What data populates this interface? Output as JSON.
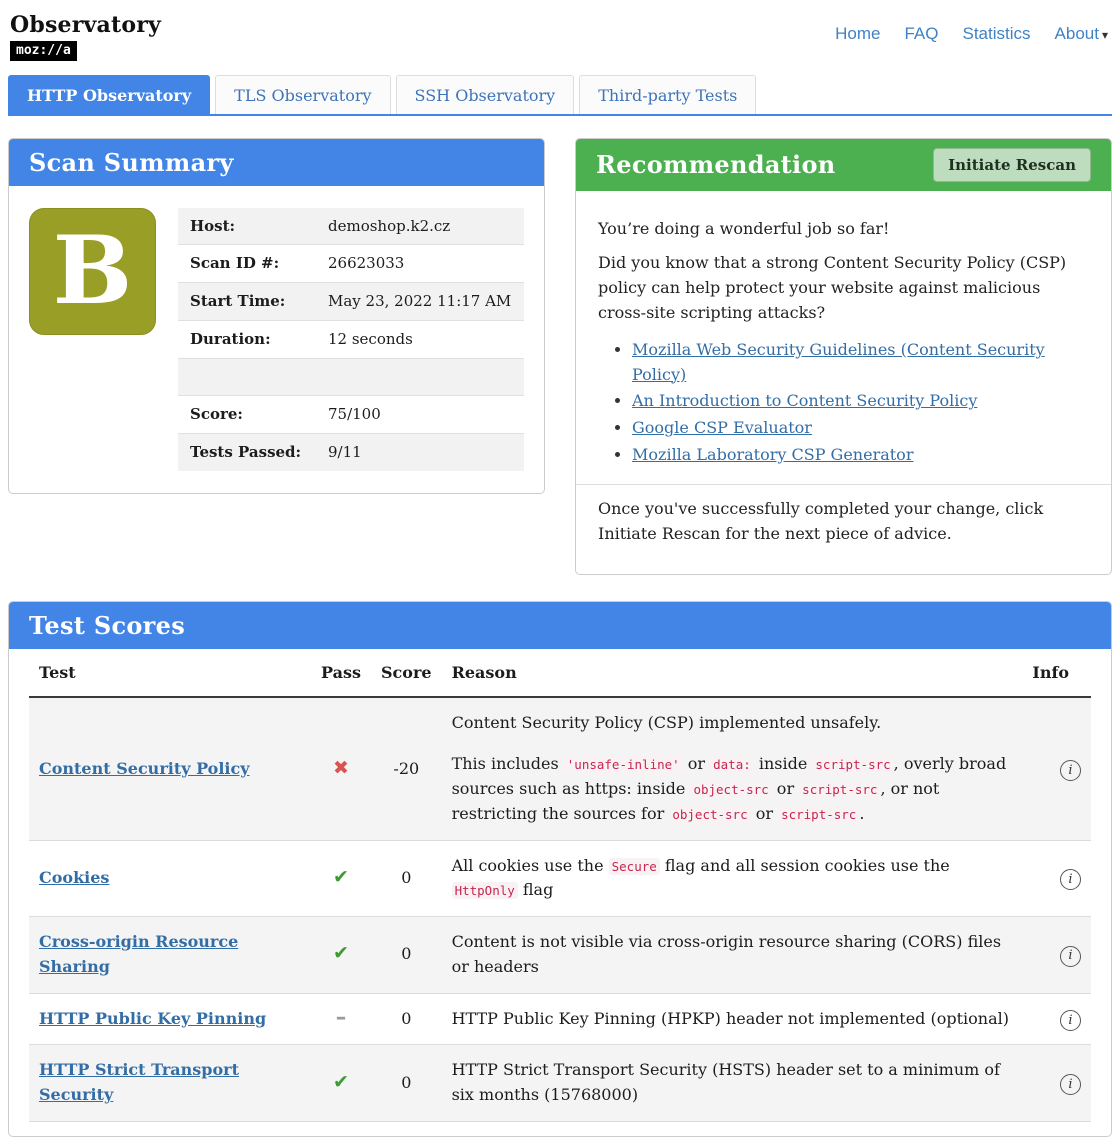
{
  "colors": {
    "accent-blue": "#4285e6",
    "accent-green": "#4caf50",
    "grade-b": "#999e26",
    "link-blue": "#336da6",
    "nav-blue": "#4082c4",
    "code-red": "#c7254e",
    "fail-red": "#d9534f",
    "pass-green": "#3d9b35",
    "neutral-gray": "#9a9a9a"
  },
  "icons": {
    "caret_down": "▾",
    "fail": "✖",
    "pass": "✔",
    "neutral": "–",
    "info": "i"
  },
  "header": {
    "title": "Observatory",
    "logo": "moz://a",
    "nav": [
      {
        "label": "Home"
      },
      {
        "label": "FAQ"
      },
      {
        "label": "Statistics"
      },
      {
        "label": "About",
        "dropdown": true
      }
    ]
  },
  "tabs": [
    {
      "label": "HTTP Observatory",
      "active": true
    },
    {
      "label": "TLS Observatory",
      "active": false
    },
    {
      "label": "SSH Observatory",
      "active": false
    },
    {
      "label": "Third-party Tests",
      "active": false
    }
  ],
  "scan_summary": {
    "title": "Scan Summary",
    "grade": "B",
    "rows": [
      {
        "label": "Host:",
        "value": "demoshop.k2.cz"
      },
      {
        "label": "Scan ID #:",
        "value": "26623033"
      },
      {
        "label": "Start Time:",
        "value": "May 23, 2022 11:17 AM"
      },
      {
        "label": "Duration:",
        "value": "12 seconds"
      },
      {
        "label": "",
        "value": ""
      },
      {
        "label": "Score:",
        "value": "75/100"
      },
      {
        "label": "Tests Passed:",
        "value": "9/11"
      }
    ]
  },
  "recommendation": {
    "title": "Recommendation",
    "button": "Initiate Rescan",
    "intro": "You’re doing a wonderful job so far!",
    "question": "Did you know that a strong Content Security Policy (CSP) policy can help protect your website against malicious cross-site scripting attacks?",
    "links": [
      "Mozilla Web Security Guidelines (Content Security Policy)",
      "An Introduction to Content Security Policy",
      "Google CSP Evaluator",
      "Mozilla Laboratory CSP Generator"
    ],
    "outro": "Once you've successfully completed your change, click Initiate Rescan for the next piece of advice."
  },
  "test_scores": {
    "title": "Test Scores",
    "columns": [
      "Test",
      "Pass",
      "Score",
      "Reason",
      "Info"
    ],
    "rows": [
      {
        "test": "Content Security Policy",
        "pass": "fail",
        "score": "-20",
        "reason": [
          [
            {
              "text": "Content Security Policy (CSP) implemented unsafely."
            }
          ],
          [
            {
              "text": "This includes "
            },
            {
              "code": "'unsafe-inline'"
            },
            {
              "text": " or "
            },
            {
              "code": "data:"
            },
            {
              "text": " inside "
            },
            {
              "code": "script-src"
            },
            {
              "text": ", overly broad sources such as https: inside "
            },
            {
              "code": "object-src"
            },
            {
              "text": " or "
            },
            {
              "code": "script-src"
            },
            {
              "text": ", or not restricting the sources for "
            },
            {
              "code": "object-src"
            },
            {
              "text": " or "
            },
            {
              "code": "script-src"
            },
            {
              "text": "."
            }
          ]
        ]
      },
      {
        "test": "Cookies",
        "pass": "pass",
        "score": "0",
        "reason": [
          [
            {
              "text": "All cookies use the "
            },
            {
              "code": "Secure"
            },
            {
              "text": " flag and all session cookies use the "
            },
            {
              "code": "HttpOnly"
            },
            {
              "text": " flag"
            }
          ]
        ]
      },
      {
        "test": "Cross-origin Resource Sharing",
        "pass": "pass",
        "score": "0",
        "reason": [
          [
            {
              "text": "Content is not visible via cross-origin resource sharing (CORS) files or headers"
            }
          ]
        ]
      },
      {
        "test": "HTTP Public Key Pinning",
        "pass": "neutral",
        "score": "0",
        "reason": [
          [
            {
              "text": "HTTP Public Key Pinning (HPKP) header not implemented (optional)"
            }
          ]
        ]
      },
      {
        "test": "HTTP Strict Transport Security",
        "pass": "pass",
        "score": "0",
        "reason": [
          [
            {
              "text": "HTTP Strict Transport Security (HSTS) header set to a minimum of six months (15768000)"
            }
          ]
        ]
      }
    ]
  }
}
